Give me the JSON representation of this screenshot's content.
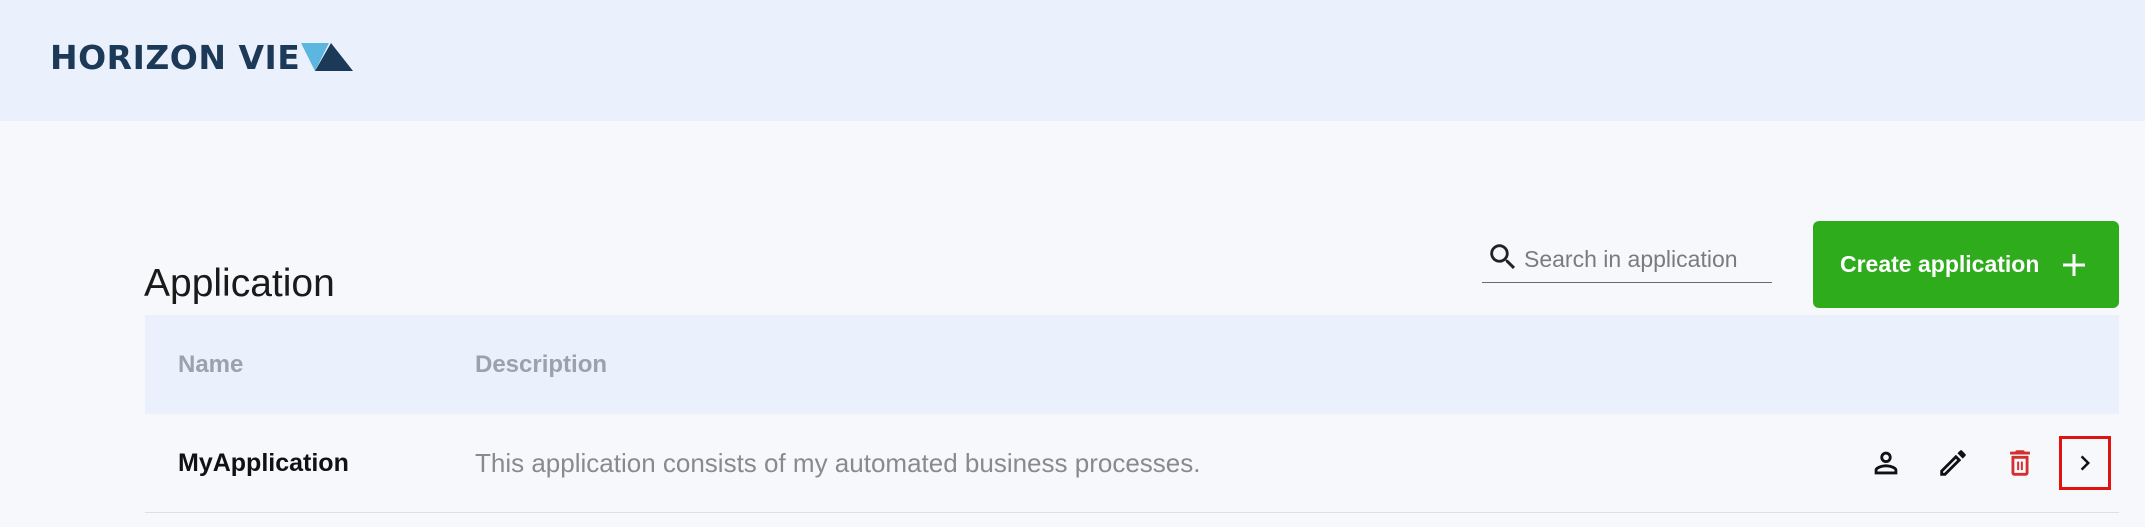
{
  "header": {
    "logo_text": "HORIZON VIE"
  },
  "page": {
    "title": "Application"
  },
  "search": {
    "placeholder": "Search in application",
    "value": ""
  },
  "toolbar": {
    "create_label": "Create application"
  },
  "table": {
    "columns": [
      "Name",
      "Description"
    ],
    "rows": [
      {
        "name": "MyApplication",
        "description": "This application consists of my automated business processes.",
        "actions": [
          "person-icon",
          "pencil-icon",
          "trash-icon",
          "chevron-right-icon"
        ]
      }
    ]
  },
  "colors": {
    "accent_green": "#2eac1c",
    "delete_red": "#d32f2f",
    "highlight_red": "#e01212",
    "header_bg": "#eaf1fd",
    "logo_navy": "#1c3a57",
    "logo_cyan": "#5bb6e0"
  }
}
